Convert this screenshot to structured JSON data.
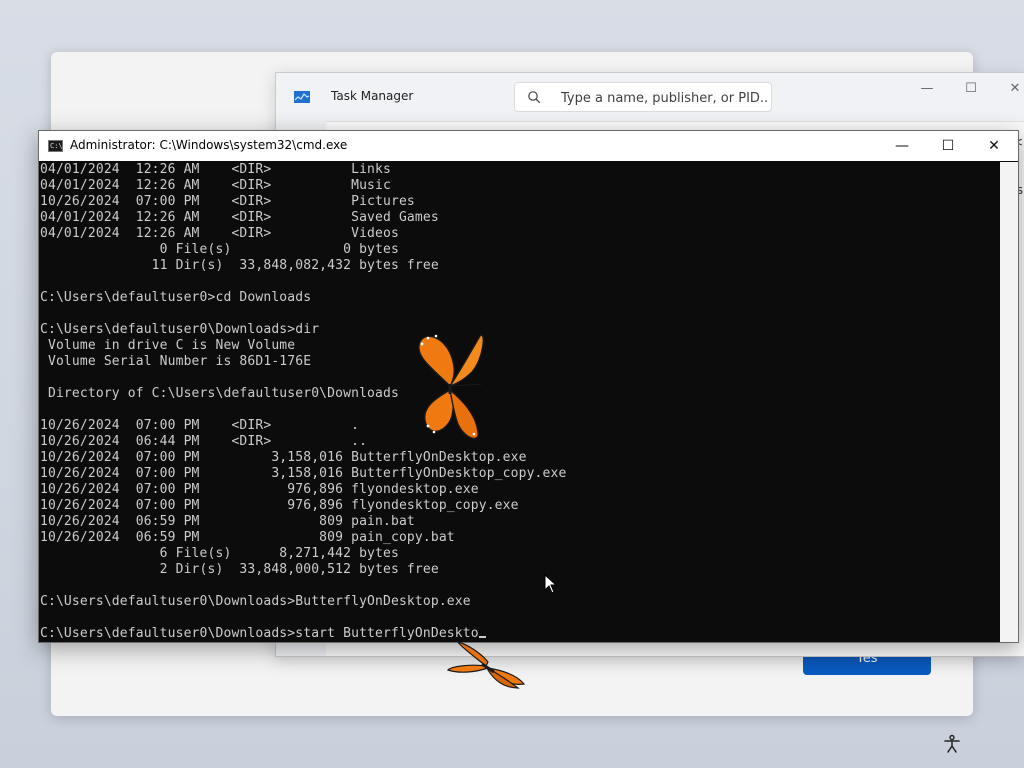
{
  "uac": {
    "yes_label": "Yes"
  },
  "task_manager": {
    "title": "Task Manager",
    "search_placeholder": "Type a name, publisher, or PID...",
    "partial_text": "s",
    "partial_arrow": "<"
  },
  "cmd": {
    "title": "Administrator: C:\\Windows\\system32\\cmd.exe",
    "icon_text": "C:\\",
    "lines": [
      "04/01/2024  12:26 AM    <DIR>          Links",
      "04/01/2024  12:26 AM    <DIR>          Music",
      "10/26/2024  07:00 PM    <DIR>          Pictures",
      "04/01/2024  12:26 AM    <DIR>          Saved Games",
      "04/01/2024  12:26 AM    <DIR>          Videos",
      "               0 File(s)              0 bytes",
      "              11 Dir(s)  33,848,082,432 bytes free",
      "",
      "C:\\Users\\defaultuser0>cd Downloads",
      "",
      "C:\\Users\\defaultuser0\\Downloads>dir",
      " Volume in drive C is New Volume",
      " Volume Serial Number is 86D1-176E",
      "",
      " Directory of C:\\Users\\defaultuser0\\Downloads",
      "",
      "10/26/2024  07:00 PM    <DIR>          .",
      "10/26/2024  06:44 PM    <DIR>          ..",
      "10/26/2024  07:00 PM         3,158,016 ButterflyOnDesktop.exe",
      "10/26/2024  07:00 PM         3,158,016 ButterflyOnDesktop_copy.exe",
      "10/26/2024  07:00 PM           976,896 flyondesktop.exe",
      "10/26/2024  07:00 PM           976,896 flyondesktop_copy.exe",
      "10/26/2024  06:59 PM               809 pain.bat",
      "10/26/2024  06:59 PM               809 pain_copy.bat",
      "               6 File(s)      8,271,442 bytes",
      "               2 Dir(s)  33,848,000,512 bytes free",
      "",
      "C:\\Users\\defaultuser0\\Downloads>ButterflyOnDesktop.exe",
      "",
      "C:\\Users\\defaultuser0\\Downloads>start ButterflyOnDeskto"
    ]
  },
  "colors": {
    "console_bg": "#0c0c0c",
    "console_text": "#cccccc",
    "accent_blue": "#0a5cc2",
    "butterfly_orange": "#f07a12"
  },
  "icons": {
    "task_manager_app": "task-manager-icon",
    "search": "search-icon",
    "cmd_app": "cmd-icon",
    "butterfly": "butterfly-icon",
    "pointer": "mouse-pointer-icon",
    "accessibility": "accessibility-icon"
  }
}
